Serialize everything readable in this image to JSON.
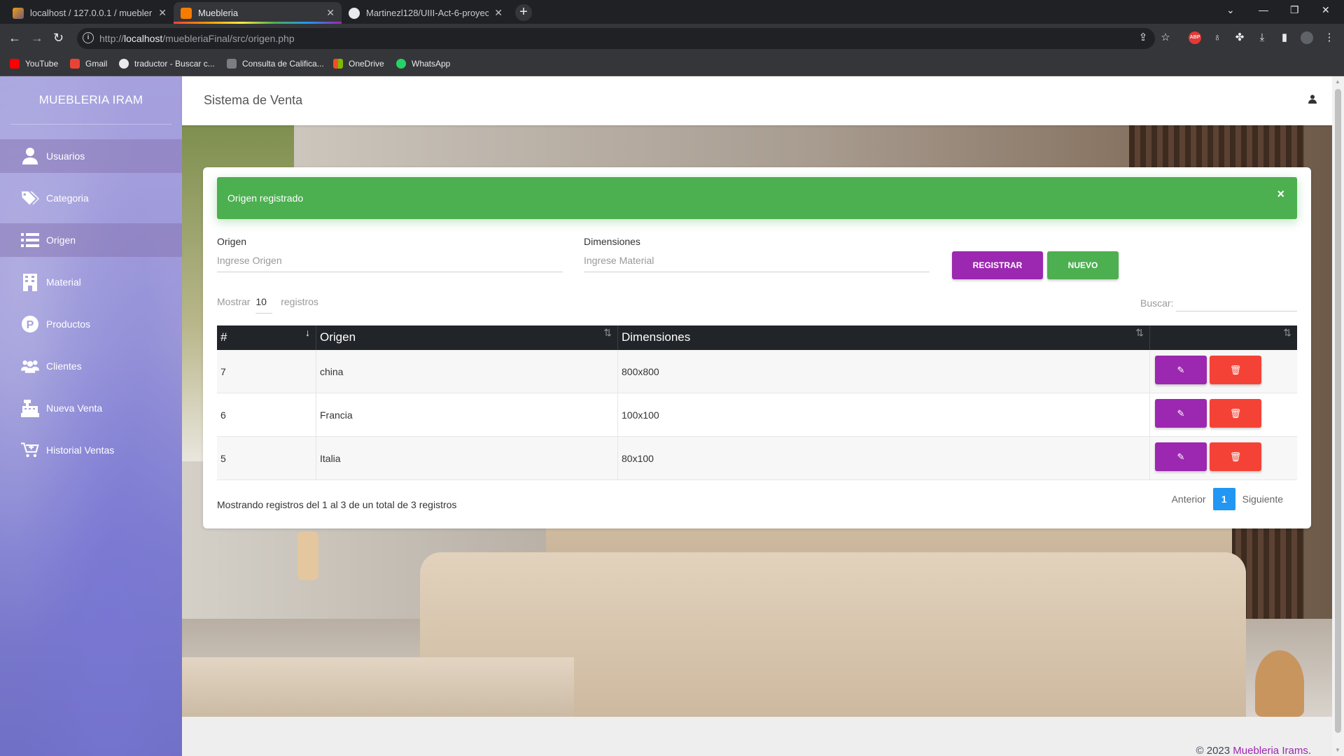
{
  "browser": {
    "tabs": [
      {
        "title": "localhost / 127.0.0.1 / muebleria",
        "active": false
      },
      {
        "title": "Muebleria",
        "active": true
      },
      {
        "title": "Martinezl128/UIII-Act-6-proyect",
        "active": false
      }
    ],
    "url_prefix": "http://",
    "url_host": "localhost",
    "url_path": "/muebleriaFinal/src/origen.php",
    "bookmarks": [
      "YouTube",
      "Gmail",
      "traductor - Buscar c...",
      "Consulta de Califica...",
      "OneDrive",
      "WhatsApp"
    ]
  },
  "sidebar": {
    "brand": "MUEBLERIA IRAM",
    "items": [
      {
        "label": "Usuarios",
        "icon": "user-icon",
        "active": true
      },
      {
        "label": "Categoria",
        "icon": "tags-icon",
        "active": false
      },
      {
        "label": "Origen",
        "icon": "list-icon",
        "active": true
      },
      {
        "label": "Material",
        "icon": "building-icon",
        "active": false
      },
      {
        "label": "Productos",
        "icon": "product-p-icon",
        "active": false
      },
      {
        "label": "Clientes",
        "icon": "users-icon",
        "active": false
      },
      {
        "label": "Nueva Venta",
        "icon": "cash-register-icon",
        "active": false
      },
      {
        "label": "Historial Ventas",
        "icon": "cart-plus-icon",
        "active": false
      }
    ]
  },
  "header": {
    "title": "Sistema de Venta"
  },
  "alert": {
    "message": "Origen registrado",
    "close": "×"
  },
  "form": {
    "origen_label": "Origen",
    "origen_placeholder": "Ingrese Origen",
    "dimensiones_label": "Dimensiones",
    "dimensiones_placeholder": "Ingrese Material",
    "register_label": "REGISTRAR",
    "new_label": "NUEVO"
  },
  "table": {
    "length_prefix": "Mostrar",
    "length_value": "10",
    "length_suffix": "registros",
    "search_label": "Buscar:",
    "columns": [
      "#",
      "Origen",
      "Dimensiones",
      ""
    ],
    "rows": [
      {
        "id": "7",
        "origen": "china",
        "dimensiones": "800x800"
      },
      {
        "id": "6",
        "origen": "Francia",
        "dimensiones": "100x100"
      },
      {
        "id": "5",
        "origen": "Italia",
        "dimensiones": "80x100"
      }
    ],
    "info": "Mostrando registros del 1 al 3 de un total de 3 registros",
    "prev": "Anterior",
    "page": "1",
    "next": "Siguiente"
  },
  "footer": {
    "copyright": "© 2023",
    "brand": "Muebleria Irams",
    "suffix": "."
  },
  "colors": {
    "primary": "#9c27b0",
    "success": "#4caf50",
    "danger": "#f44336",
    "info": "#2196f3",
    "table_header": "#212529"
  }
}
